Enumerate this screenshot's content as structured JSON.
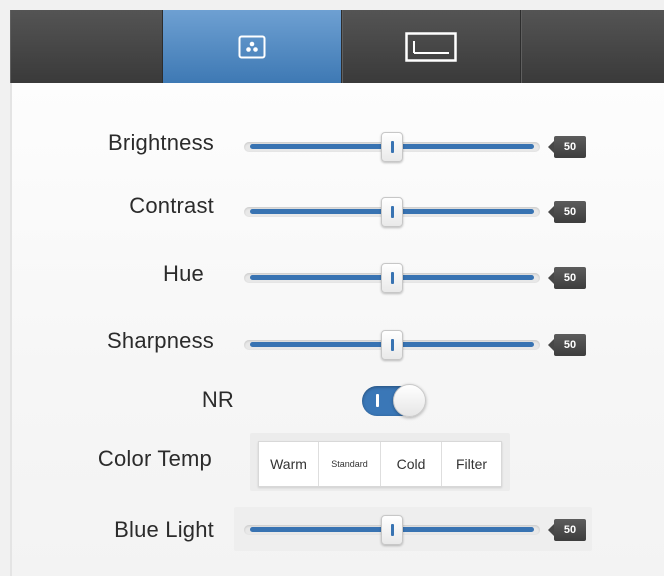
{
  "tabs": [
    {
      "icon": "picture-settings-icon",
      "active": true
    },
    {
      "icon": "screen-frame-icon",
      "active": false
    },
    {
      "icon": "",
      "active": false
    }
  ],
  "settings": {
    "brightness": {
      "label": "Brightness",
      "value": "50",
      "level": 0.5
    },
    "contrast": {
      "label": "Contrast",
      "value": "50",
      "level": 0.5
    },
    "hue": {
      "label": "Hue",
      "value": "50",
      "level": 0.5
    },
    "sharpness": {
      "label": "Sharpness",
      "value": "50",
      "level": 0.5
    },
    "nr": {
      "label": "NR",
      "on": true
    },
    "color_temp": {
      "label": "Color Temp",
      "options": [
        "Warm",
        "Standard",
        "Cold",
        "Filter"
      ]
    },
    "blue_light": {
      "label": "Blue Light",
      "value": "50",
      "level": 0.5
    }
  },
  "colors": {
    "accent": "#3873b2",
    "tab_bar": "#444444",
    "value_badge": "#4a4a4a"
  }
}
